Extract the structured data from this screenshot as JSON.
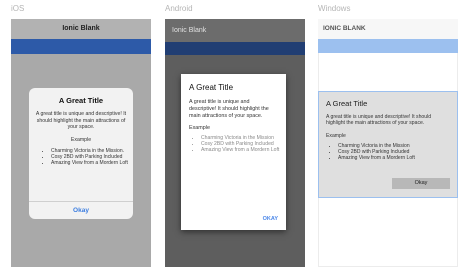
{
  "platforms": {
    "ios": {
      "label": "iOS",
      "header_title": "Ionic Blank",
      "dialog": {
        "title": "A Great Title",
        "message": "A great title is unique and descriptive! It should highlight the main attractions of your space.",
        "example_label": "Example",
        "items": [
          "Charming Victoria in the Mission.",
          "Cosy 2BD with Parking Included",
          "Amazing View from a Mordern Loft"
        ],
        "button": "Okay"
      }
    },
    "android": {
      "label": "Android",
      "header_title": "Ionic Blank",
      "dialog": {
        "title": "A Great Title",
        "message": "A great title is unique and descriptive! It should highlight the main attractions of your space.",
        "example_label": "Example",
        "items": [
          "Charming Victoria in the Mission",
          "Cosy 2BD with Parking Included",
          "Amazing View from a Mordern Loft"
        ],
        "button": "OKAY"
      }
    },
    "windows": {
      "label": "Windows",
      "header_title": "IONIC BLANK",
      "dialog": {
        "title": "A Great Title",
        "message": "A great title is unique and descriptive! It should highlight the main attractions of your space.",
        "example_label": "Example",
        "items": [
          "Charming Victoria in the Mission",
          "Cosy 2BD with Parking Included",
          "Amazing View from a Mordern Loft"
        ],
        "button": "Okay"
      }
    }
  },
  "colors": {
    "ios_bar": "#2d5aa8",
    "android_bar": "#213e73",
    "windows_bar": "#9cc0ef",
    "ios_button_text": "#3b7de0",
    "android_button_text": "#4a86e8"
  }
}
